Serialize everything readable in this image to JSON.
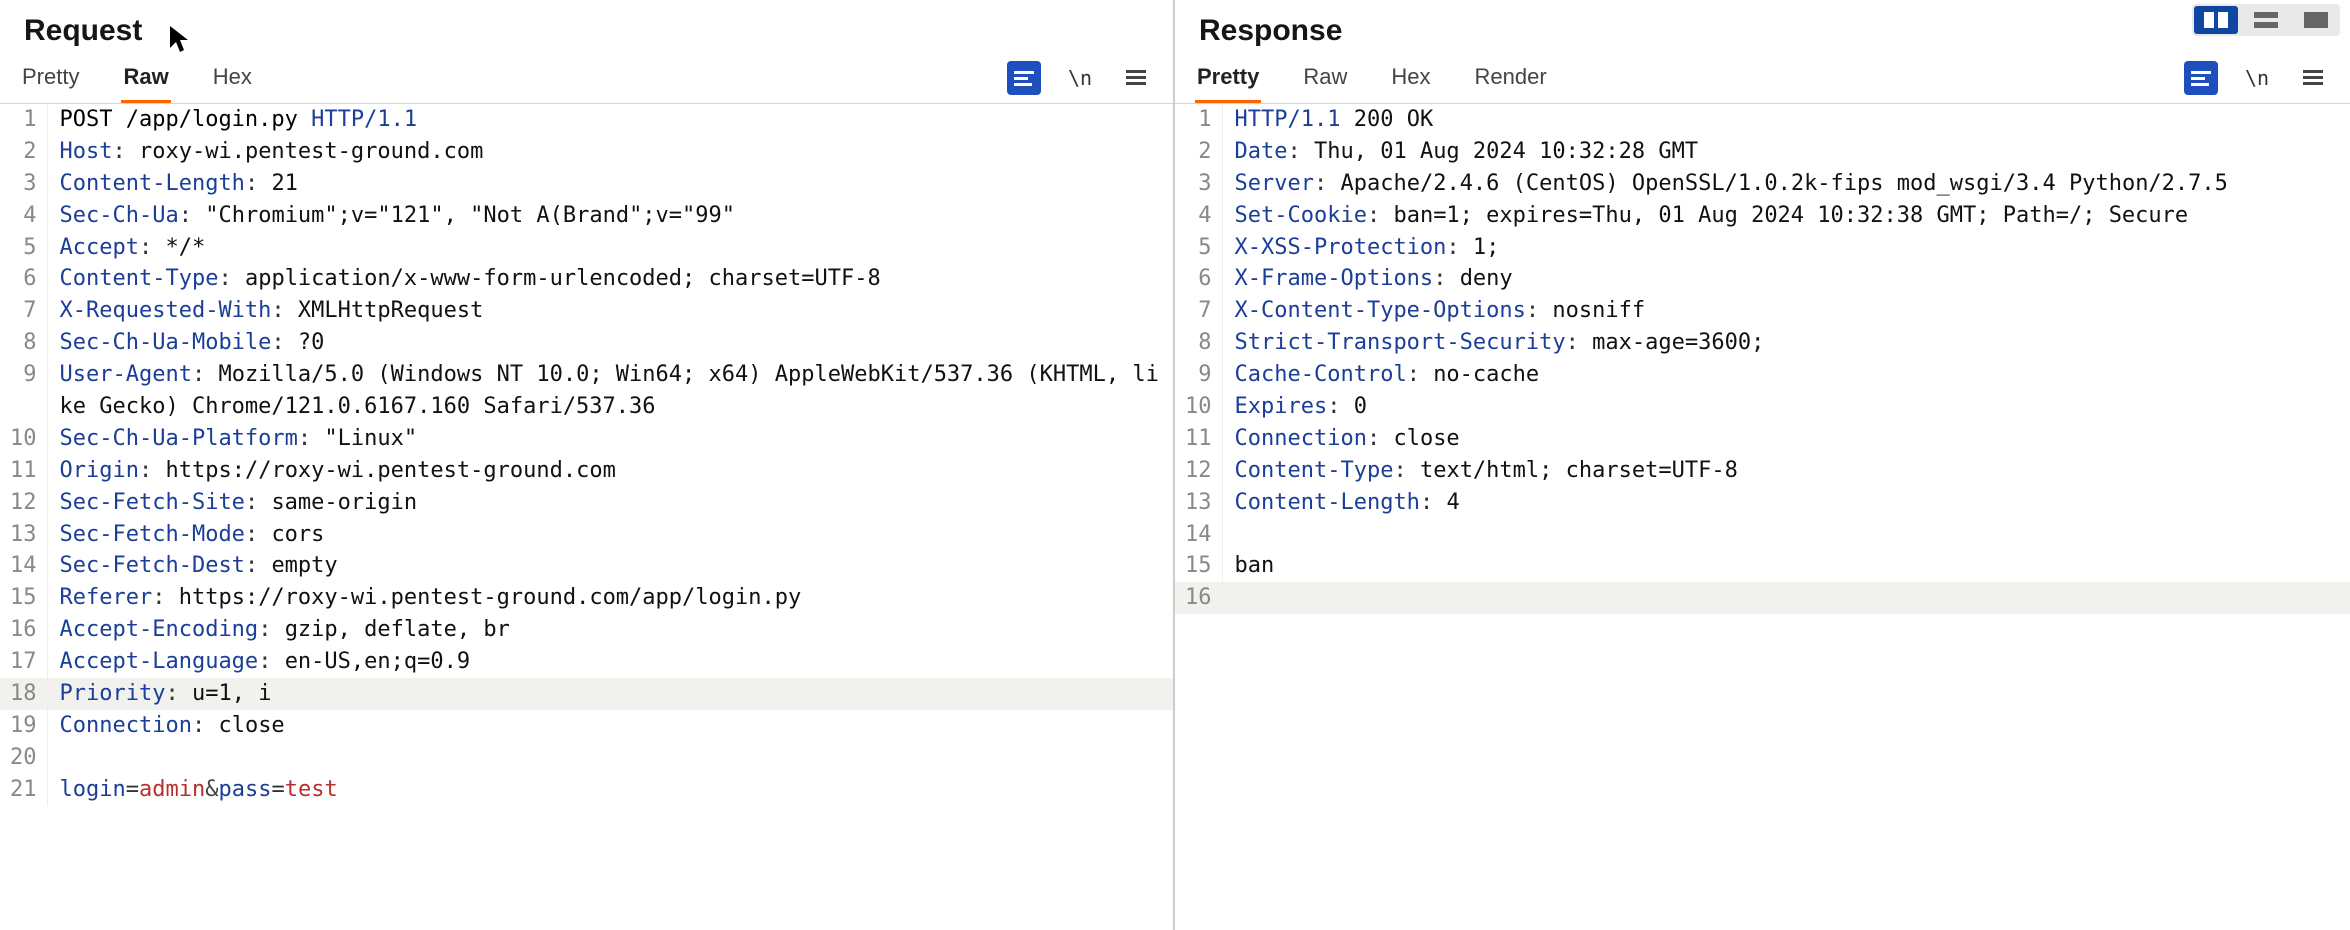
{
  "layout_buttons": [
    "columns",
    "stacked",
    "single"
  ],
  "layout_active": 0,
  "request": {
    "title": "Request",
    "tabs": [
      "Pretty",
      "Raw",
      "Hex"
    ],
    "active_tab": 1,
    "actions": [
      "beautify-icon",
      "wrap-icon",
      "menu-icon"
    ],
    "highlight_line": 18,
    "lines": [
      {
        "n": 1,
        "type": "start",
        "method": "POST",
        "path": "/app/login.py",
        "proto": "HTTP/1.1"
      },
      {
        "n": 2,
        "type": "header",
        "name": "Host",
        "value": "roxy-wi.pentest-ground.com"
      },
      {
        "n": 3,
        "type": "header",
        "name": "Content-Length",
        "value": "21"
      },
      {
        "n": 4,
        "type": "header",
        "name": "Sec-Ch-Ua",
        "value": "\"Chromium\";v=\"121\", \"Not A(Brand\";v=\"99\""
      },
      {
        "n": 5,
        "type": "header",
        "name": "Accept",
        "value": "*/*"
      },
      {
        "n": 6,
        "type": "header",
        "name": "Content-Type",
        "value": "application/x-www-form-urlencoded; charset=UTF-8"
      },
      {
        "n": 7,
        "type": "header",
        "name": "X-Requested-With",
        "value": "XMLHttpRequest"
      },
      {
        "n": 8,
        "type": "header",
        "name": "Sec-Ch-Ua-Mobile",
        "value": "?0"
      },
      {
        "n": 9,
        "type": "header",
        "name": "User-Agent",
        "value": "Mozilla/5.0 (Windows NT 10.0; Win64; x64) AppleWebKit/537.36 (KHTML, like Gecko) Chrome/121.0.6167.160 Safari/537.36"
      },
      {
        "n": 10,
        "type": "header",
        "name": "Sec-Ch-Ua-Platform",
        "value": "\"Linux\""
      },
      {
        "n": 11,
        "type": "header",
        "name": "Origin",
        "value": "https://roxy-wi.pentest-ground.com"
      },
      {
        "n": 12,
        "type": "header",
        "name": "Sec-Fetch-Site",
        "value": "same-origin"
      },
      {
        "n": 13,
        "type": "header",
        "name": "Sec-Fetch-Mode",
        "value": "cors"
      },
      {
        "n": 14,
        "type": "header",
        "name": "Sec-Fetch-Dest",
        "value": "empty"
      },
      {
        "n": 15,
        "type": "header",
        "name": "Referer",
        "value": "https://roxy-wi.pentest-ground.com/app/login.py"
      },
      {
        "n": 16,
        "type": "header",
        "name": "Accept-Encoding",
        "value": "gzip, deflate, br"
      },
      {
        "n": 17,
        "type": "header",
        "name": "Accept-Language",
        "value": "en-US,en;q=0.9"
      },
      {
        "n": 18,
        "type": "header",
        "name": "Priority",
        "value": "u=1, i"
      },
      {
        "n": 19,
        "type": "header",
        "name": "Connection",
        "value": "close"
      },
      {
        "n": 20,
        "type": "blank"
      },
      {
        "n": 21,
        "type": "body",
        "params": [
          {
            "k": "login",
            "v": "admin"
          },
          {
            "k": "pass",
            "v": "test"
          }
        ]
      }
    ]
  },
  "response": {
    "title": "Response",
    "tabs": [
      "Pretty",
      "Raw",
      "Hex",
      "Render"
    ],
    "active_tab": 0,
    "actions": [
      "beautify-icon",
      "wrap-icon",
      "menu-icon"
    ],
    "highlight_line": 16,
    "lines": [
      {
        "n": 1,
        "type": "start",
        "proto": "HTTP/1.1",
        "status": "200 OK"
      },
      {
        "n": 2,
        "type": "header",
        "name": "Date",
        "value": "Thu, 01 Aug 2024 10:32:28 GMT"
      },
      {
        "n": 3,
        "type": "header",
        "name": "Server",
        "value": "Apache/2.4.6 (CentOS) OpenSSL/1.0.2k-fips mod_wsgi/3.4 Python/2.7.5"
      },
      {
        "n": 4,
        "type": "header",
        "name": "Set-Cookie",
        "value": "ban=1; expires=Thu, 01 Aug 2024 10:32:38 GMT; Path=/; Secure"
      },
      {
        "n": 5,
        "type": "header",
        "name": "X-XSS-Protection",
        "value": "1;"
      },
      {
        "n": 6,
        "type": "header",
        "name": "X-Frame-Options",
        "value": "deny"
      },
      {
        "n": 7,
        "type": "header",
        "name": "X-Content-Type-Options",
        "value": "nosniff"
      },
      {
        "n": 8,
        "type": "header",
        "name": "Strict-Transport-Security",
        "value": "max-age=3600;"
      },
      {
        "n": 9,
        "type": "header",
        "name": "Cache-Control",
        "value": "no-cache"
      },
      {
        "n": 10,
        "type": "header",
        "name": "Expires",
        "value": "0"
      },
      {
        "n": 11,
        "type": "header",
        "name": "Connection",
        "value": "close"
      },
      {
        "n": 12,
        "type": "header",
        "name": "Content-Type",
        "value": "text/html; charset=UTF-8"
      },
      {
        "n": 13,
        "type": "header",
        "name": "Content-Length",
        "value": "4"
      },
      {
        "n": 14,
        "type": "blank"
      },
      {
        "n": 15,
        "type": "text",
        "text": "ban"
      },
      {
        "n": 16,
        "type": "blank"
      }
    ]
  }
}
